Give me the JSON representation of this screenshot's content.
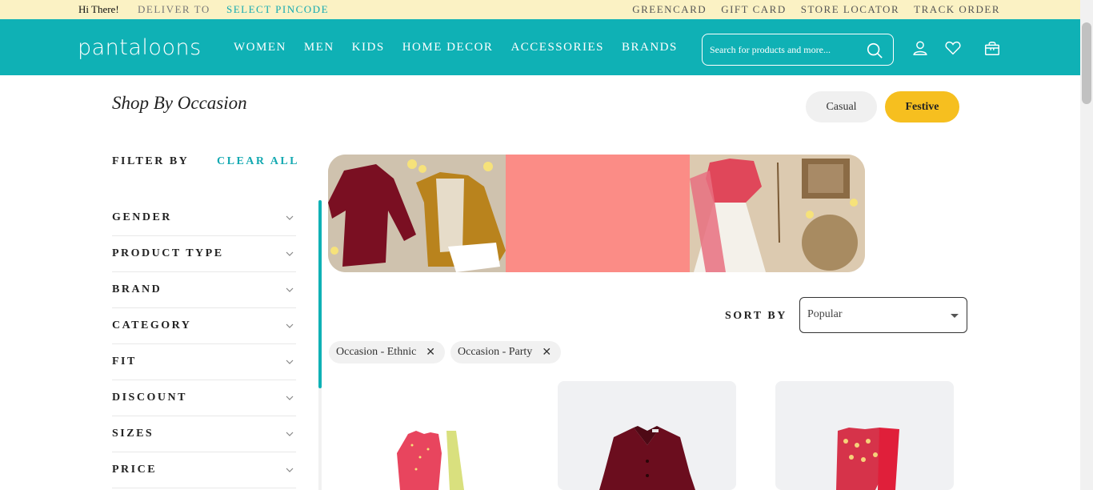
{
  "topbar": {
    "greeting": "Hi There!",
    "deliver_to": "DELIVER TO",
    "select_pincode": "SELECT PINCODE",
    "links": [
      "GREENCARD",
      "GIFT CARD",
      "STORE LOCATOR",
      "TRACK ORDER"
    ]
  },
  "header": {
    "logo": "pantaloons",
    "nav": [
      "WOMEN",
      "MEN",
      "KIDS",
      "HOME DECOR",
      "ACCESSORIES",
      "BRANDS"
    ],
    "search_placeholder": "Search for products and more...",
    "icons": [
      "search-icon",
      "user-icon",
      "heart-icon",
      "bag-icon"
    ],
    "brand_color": "#0fb1b5"
  },
  "page": {
    "title": "Shop By Occasion",
    "occasions": [
      "Casual",
      "Festive"
    ],
    "active_occasion": "Festive",
    "accent_color": "#f6bf1f"
  },
  "filters": {
    "heading": "FILTER BY",
    "clear_all": "CLEAR ALL",
    "groups": [
      "GENDER",
      "PRODUCT TYPE",
      "BRAND",
      "CATEGORY",
      "FIT",
      "DISCOUNT",
      "SIZES",
      "PRICE"
    ]
  },
  "sort": {
    "label": "SORT BY",
    "selected": "Popular"
  },
  "applied_filters": [
    "Occasion - Ethnic",
    "Occasion - Party"
  ]
}
